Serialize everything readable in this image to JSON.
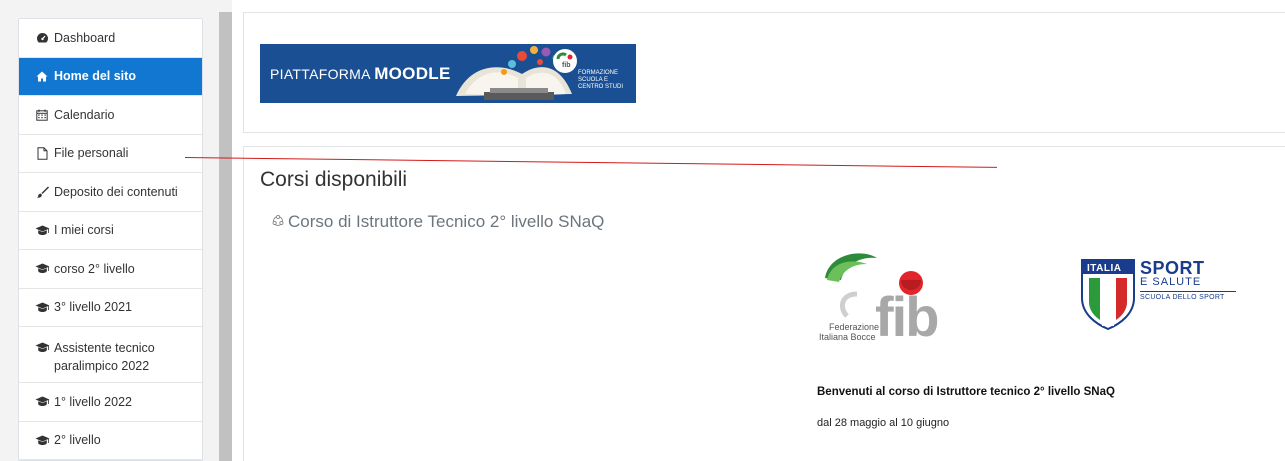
{
  "nav": {
    "items": [
      {
        "label": "Dashboard",
        "icon": "dashboard-icon",
        "active": false
      },
      {
        "label": "Home del sito",
        "icon": "home-icon",
        "active": true
      },
      {
        "label": "Calendario",
        "icon": "calendar-icon",
        "active": false
      },
      {
        "label": "File personali",
        "icon": "file-icon",
        "active": false
      },
      {
        "label": "Deposito dei contenuti",
        "icon": "brush-icon",
        "active": false
      },
      {
        "label": "I miei corsi",
        "icon": "graduation-cap-icon",
        "active": false
      },
      {
        "label": "corso 2° livello",
        "icon": "graduation-cap-icon",
        "active": false
      },
      {
        "label": "3° livello 2021",
        "icon": "graduation-cap-icon",
        "active": false
      },
      {
        "label": "Assistente tecnico paralimpico 2022",
        "icon": "graduation-cap-icon",
        "active": false
      },
      {
        "label": "1° livello 2022",
        "icon": "graduation-cap-icon",
        "active": false
      },
      {
        "label": "2° livello",
        "icon": "graduation-cap-icon",
        "active": false
      }
    ]
  },
  "banner": {
    "title_prefix": "PIATTAFORMA ",
    "title_bold": "MOODLE",
    "subtitle": "FORMAZIONE SCUOLA E CENTRO STUDI",
    "badge": "fib"
  },
  "main": {
    "section_title": "Corsi disponibili",
    "course_name": "Corso di Istruttore Tecnico 2° livello SNaQ",
    "welcome": "Benvenuti al corso di Istruttore tecnico 2° livello SNaQ",
    "dates": "dal 28 maggio al 10 giugno"
  },
  "fib_logo": {
    "text": "fib",
    "caption_line1": "Federazione",
    "caption_line2": "Italiana Bocce"
  },
  "sport_logo": {
    "italia": "ITALIA",
    "sport": "SPORT",
    "salute": "E SALUTE",
    "scuola": "SCUOLA DELLO SPORT"
  },
  "colors": {
    "accent": "#1177d1",
    "banner": "#1a4f93",
    "fib_green": "#2e8b3a",
    "fib_red": "#e0262b",
    "annotation_line": "#d21a1a"
  }
}
